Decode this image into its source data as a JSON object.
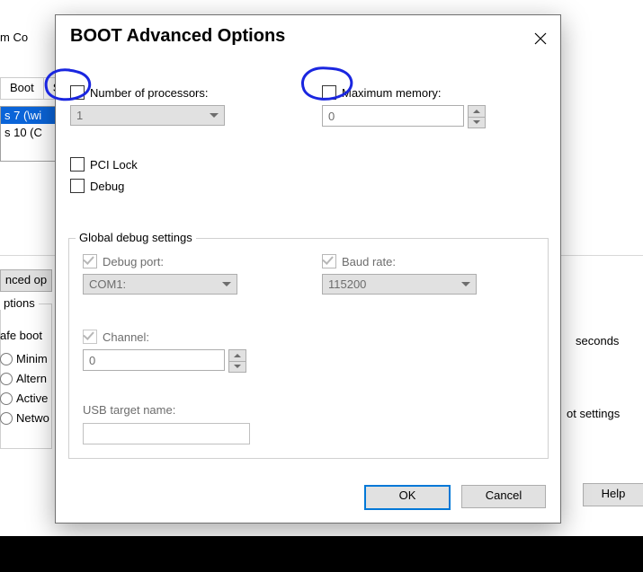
{
  "background": {
    "window_title_fragment": "m Co",
    "tab_boot": "Boot",
    "tab_services_fragment": "S",
    "list_selected": "s 7 (\\wi",
    "list_other": "s 10 (C",
    "advanced_button_fragment": "nced op",
    "boot_options_title_fragment": "ptions",
    "safe_boot_fragment": "afe boot",
    "radio_minimal": "Minim",
    "radio_altshell": "Altern",
    "radio_active": "Active",
    "radio_network": "Netwo",
    "seconds_label": "seconds",
    "permanent_fragment": "ot settings",
    "help_button": "Help"
  },
  "dialog": {
    "title": "BOOT Advanced Options",
    "num_processors_label": "Number of processors:",
    "num_processors_value": "1",
    "max_memory_label": "Maximum memory:",
    "max_memory_value": "0",
    "pci_lock_label": "PCI Lock",
    "debug_label": "Debug",
    "global_group": "Global debug settings",
    "debug_port_label": "Debug port:",
    "debug_port_value": "COM1:",
    "baud_rate_label": "Baud rate:",
    "baud_rate_value": "115200",
    "channel_label": "Channel:",
    "channel_value": "0",
    "usb_target_label": "USB target name:",
    "ok_button": "OK",
    "cancel_button": "Cancel"
  }
}
